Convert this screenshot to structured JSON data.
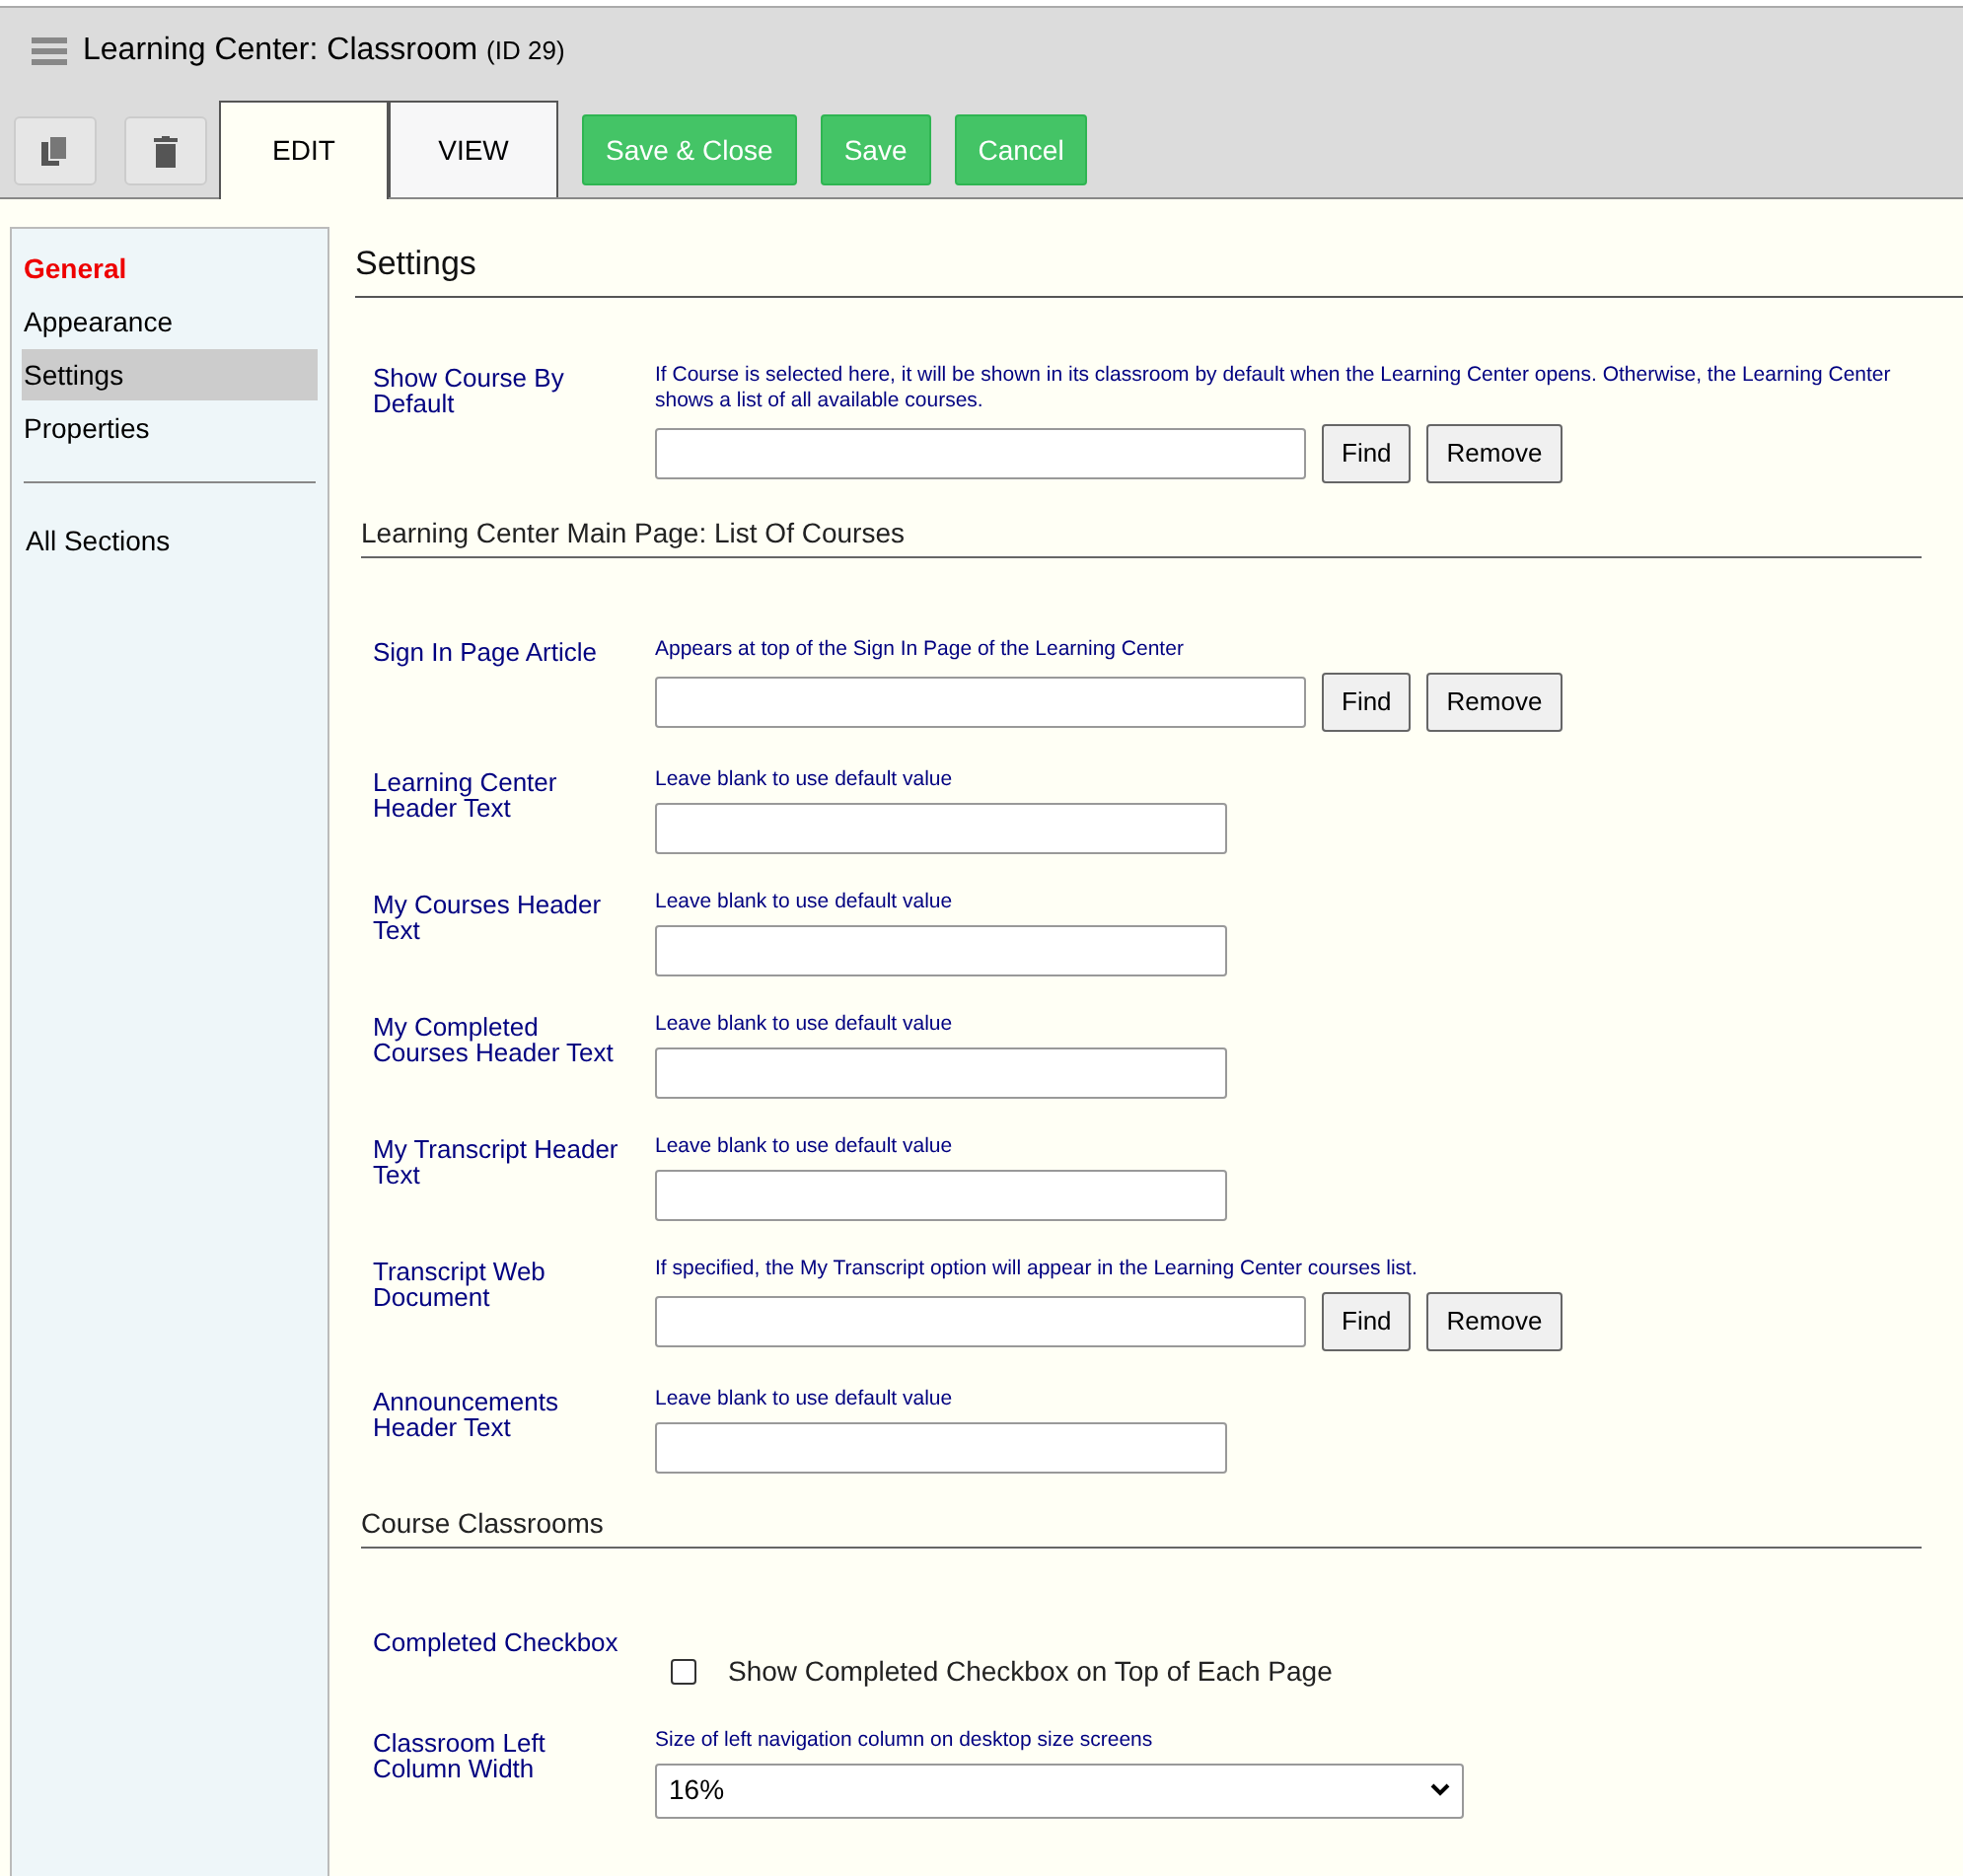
{
  "window": {
    "title": "Learning Center: Classroom",
    "title_note": "(ID 29)"
  },
  "tabs": [
    {
      "label": "EDIT",
      "selected": true
    },
    {
      "label": "VIEW",
      "selected": false
    }
  ],
  "actions": [
    "Save & Close",
    "Save",
    "Cancel"
  ],
  "sidebar": {
    "groups": [
      {
        "items": [
          {
            "label": "General",
            "kind": "heading",
            "selected": false
          },
          {
            "label": "Appearance",
            "kind": "link",
            "selected": false
          },
          {
            "label": "Settings",
            "kind": "link",
            "selected": true
          },
          {
            "label": "Properties",
            "kind": "link",
            "selected": false
          }
        ]
      },
      {
        "items": [
          {
            "label": "All Sections",
            "kind": "link",
            "selected": false
          }
        ]
      }
    ]
  },
  "page_title": "Settings",
  "sections": [
    {
      "fields": [
        {
          "kind": "lookup",
          "label": "Show Course By Default",
          "hint": "If Course is selected here, it will be shown in its classroom by default when the Learning Center opens. Otherwise, the Learning Center shows a list of all available courses.",
          "buttons": [
            "Find",
            "Remove"
          ]
        }
      ]
    },
    {
      "heading": "Learning Center Main Page: List Of Courses",
      "fields": [
        {
          "kind": "lookup",
          "label": "Sign In Page Article",
          "hint": "Appears at top of the Sign In Page of the Learning Center",
          "buttons": [
            "Find",
            "Remove"
          ]
        },
        {
          "kind": "text",
          "label": "Learning Center Header Text",
          "hint": "Leave blank to use default value"
        },
        {
          "kind": "text",
          "label": "My Courses Header Text",
          "hint": "Leave blank to use default value"
        },
        {
          "kind": "text",
          "label": "My Completed Courses Header Text",
          "hint": "Leave blank to use default value"
        },
        {
          "kind": "text",
          "label": "My Transcript Header Text",
          "hint": "Leave blank to use default value"
        },
        {
          "kind": "lookup",
          "label": "Transcript Web Document",
          "hint": "If specified, the My Transcript option will appear in the Learning Center courses list.",
          "buttons": [
            "Find",
            "Remove"
          ]
        },
        {
          "kind": "text",
          "label": "Announcements Header Text",
          "hint": "Leave blank to use default value"
        }
      ]
    },
    {
      "heading": "Course Classrooms",
      "fields": [
        {
          "kind": "checkbox",
          "label": "Completed Checkbox",
          "option": "Show Completed Checkbox on Top of Each Page",
          "checked": false
        },
        {
          "kind": "select",
          "label": "Classroom Left Column Width",
          "hint": "Size of left navigation column on desktop size screens",
          "value": "16%"
        }
      ]
    }
  ]
}
